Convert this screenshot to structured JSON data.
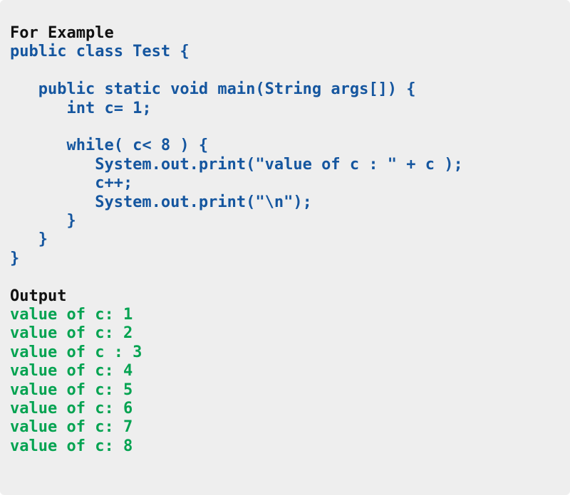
{
  "panel": {
    "background_color": "#eeeeee",
    "heading_color": "#111111",
    "code_color": "#15569f",
    "output_color": "#04a351"
  },
  "example": {
    "heading": "For Example",
    "lines": [
      "public class Test {",
      "",
      "   public static void main(String args[]) {",
      "      int c= 1;",
      "",
      "      while( c< 8 ) {",
      "         System.out.print(\"value of c : \" + c );",
      "         c++;",
      "         System.out.print(\"\\n\");",
      "      }",
      "   }",
      "}"
    ]
  },
  "output": {
    "heading": "Output",
    "lines": [
      "value of c: 1",
      "value of c: 2",
      "value of c : 3",
      "value of c: 4",
      "value of c: 5",
      "value of c: 6",
      "value of c: 7",
      "value of c: 8"
    ]
  }
}
